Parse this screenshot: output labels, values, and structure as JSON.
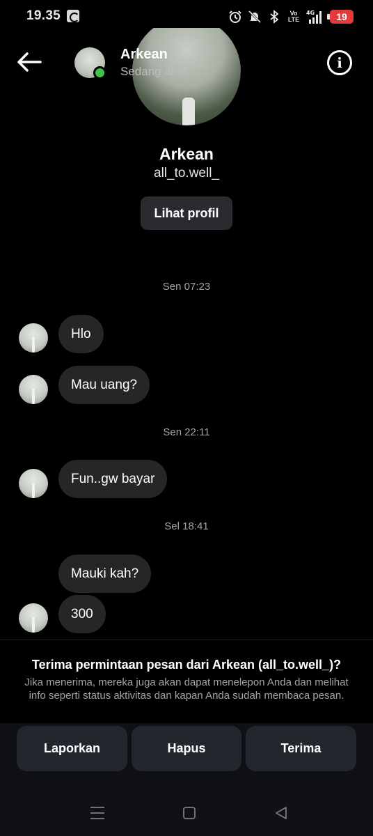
{
  "status_bar": {
    "time": "19.35",
    "volte": "Vo\nLTE",
    "network": "4G",
    "battery": "19"
  },
  "header": {
    "name": "Arkean",
    "status": "Sedang aktif"
  },
  "profile": {
    "name": "Arkean",
    "handle": "all_to.well_",
    "view_profile_label": "Lihat profil"
  },
  "chat": {
    "timestamps": [
      "Sen 07:23",
      "Sen 22:11",
      "Sel 18:41"
    ],
    "messages": [
      "Hlo",
      "Mau uang?",
      "Fun..gw bayar",
      "Mauki kah?",
      "300"
    ]
  },
  "request": {
    "title": "Terima permintaan pesan dari Arkean (all_to.well_)?",
    "body": "Jika menerima, mereka juga akan dapat menelepon Anda dan melihat info seperti status aktivitas dan kapan Anda sudah membaca pesan."
  },
  "actions": {
    "report": "Laporkan",
    "delete": "Hapus",
    "accept": "Terima"
  },
  "colors": {
    "background": "#000000",
    "bubble": "#262626",
    "active": "#3ec24a",
    "battery_low": "#e23b3b"
  }
}
